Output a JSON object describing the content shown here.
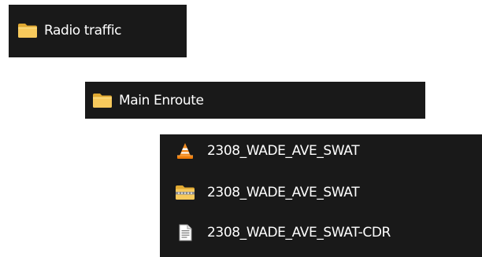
{
  "explorer": {
    "folder_1": {
      "label": "Radio traffic",
      "icon": "folder-icon"
    },
    "folder_2": {
      "label": "Main Enroute",
      "icon": "folder-icon"
    },
    "files": [
      {
        "label": "2308_WADE_AVE_SWAT",
        "icon": "vlc-media-icon"
      },
      {
        "label": "2308_WADE_AVE_SWAT",
        "icon": "zip-folder-icon"
      },
      {
        "label": "2308_WADE_AVE_SWAT-CDR",
        "icon": "text-document-icon"
      }
    ]
  },
  "colors": {
    "panel_background": "#191919",
    "text": "#ffffff",
    "folder_yellow": "#f7c95c",
    "vlc_orange": "#f28b1f"
  }
}
